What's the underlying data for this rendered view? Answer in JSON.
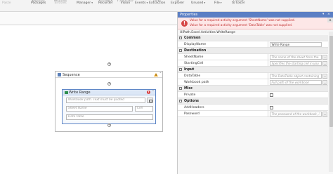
{
  "ribbon": {
    "items": [
      {
        "label": "Paste",
        "dim": true
      },
      {
        "label": "Packages",
        "top": "Manage",
        "dim": false
      },
      {
        "label": "Entities",
        "top": "Manage",
        "dim": true
      },
      {
        "label": "Manager",
        "caret": true,
        "dim": false
      },
      {
        "label": "Recorder",
        "top": "App/Web",
        "dim": false
      },
      {
        "label": "Vision",
        "top": "Computer",
        "dim": false
      },
      {
        "label": "Events",
        "caret": true,
        "dim": false
      },
      {
        "label": "Extraction",
        "top": "Data",
        "dim": false
      },
      {
        "label": "Explorer",
        "top": "UI",
        "dim": false
      },
      {
        "label": "Unused",
        "caret": true,
        "dim": false
      },
      {
        "label": "File",
        "caret": true,
        "dim": false
      },
      {
        "label": "to Excel",
        "top": "Export",
        "dim": false
      }
    ]
  },
  "designer": {
    "sequence": {
      "title": "Sequence",
      "warning_mark": "!",
      "collapse_glyph": "⌃"
    },
    "activity": {
      "title": "Write Range",
      "error_mark": "!",
      "collapse_glyph": "⌃",
      "workbook_placeholder": "Workbook path. Text must be quoted",
      "sheet_placeholder": "Sheet Name",
      "cell_placeholder": "Cell",
      "datatable_placeholder": "Data table"
    },
    "plus_glyph": "+"
  },
  "properties": {
    "title": "Properties",
    "pin_glyph": "▾",
    "close_glyph": "×",
    "errors": [
      "Value for a required activity argument 'SheetName' was not supplied.",
      "Value for a required activity argument 'DataTable' was not supplied."
    ],
    "error_glyph": "!",
    "type_name": "UiPath.Excel.Activities.WriteRange",
    "rows": [
      {
        "kind": "cat",
        "label": "Common",
        "toggle": "−"
      },
      {
        "kind": "prop",
        "label": "DisplayName",
        "value": "Write Range",
        "placeholder": false,
        "ellipsis": false
      },
      {
        "kind": "cat",
        "label": "Destination",
        "toggle": "−"
      },
      {
        "kind": "prop",
        "label": "SheetName",
        "value": "The name of the sheet from the",
        "placeholder": true,
        "ellipsis": true
      },
      {
        "kind": "prop",
        "label": "StartingCell",
        "value": "Specifies the starting cell in you",
        "placeholder": true,
        "ellipsis": true
      },
      {
        "kind": "cat",
        "label": "Input",
        "toggle": "−"
      },
      {
        "kind": "prop",
        "label": "DataTable",
        "value": "The DataTable object containing",
        "placeholder": true,
        "ellipsis": true
      },
      {
        "kind": "prop",
        "label": "Workbook path",
        "value": "Full path of the workbook",
        "placeholder": true,
        "ellipsis": true
      },
      {
        "kind": "cat",
        "label": "Misc",
        "toggle": "−"
      },
      {
        "kind": "check",
        "label": "Private"
      },
      {
        "kind": "cat",
        "label": "Options",
        "toggle": "−"
      },
      {
        "kind": "check",
        "label": "AddHeaders"
      },
      {
        "kind": "prop",
        "label": "Password",
        "value": "The password of the workbook, i",
        "placeholder": true,
        "ellipsis": true
      }
    ],
    "ellipsis_glyph": "…"
  },
  "colors": {
    "titlebar": "#5b7fc4",
    "error_text": "#c23030",
    "warning": "#f1a81e",
    "activity_border": "#5f87c7"
  }
}
